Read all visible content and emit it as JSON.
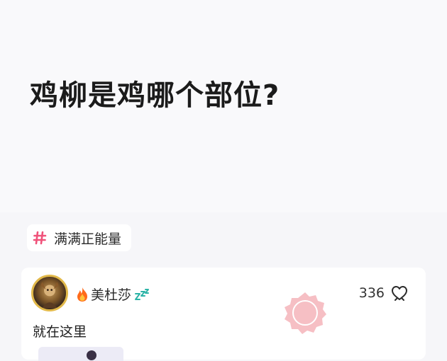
{
  "question": {
    "title": "鸡柳是鸡哪个部位?"
  },
  "topic": {
    "icon": "hash-icon",
    "label": "满满正能量",
    "accent_color": "#f0527a"
  },
  "answer": {
    "author": {
      "name": "美杜莎",
      "badge_icon": "flame-icon",
      "status_icon": "sleep-zzz-icon"
    },
    "like_count": "336",
    "like_icon": "like-icon",
    "text": "就在这里"
  }
}
